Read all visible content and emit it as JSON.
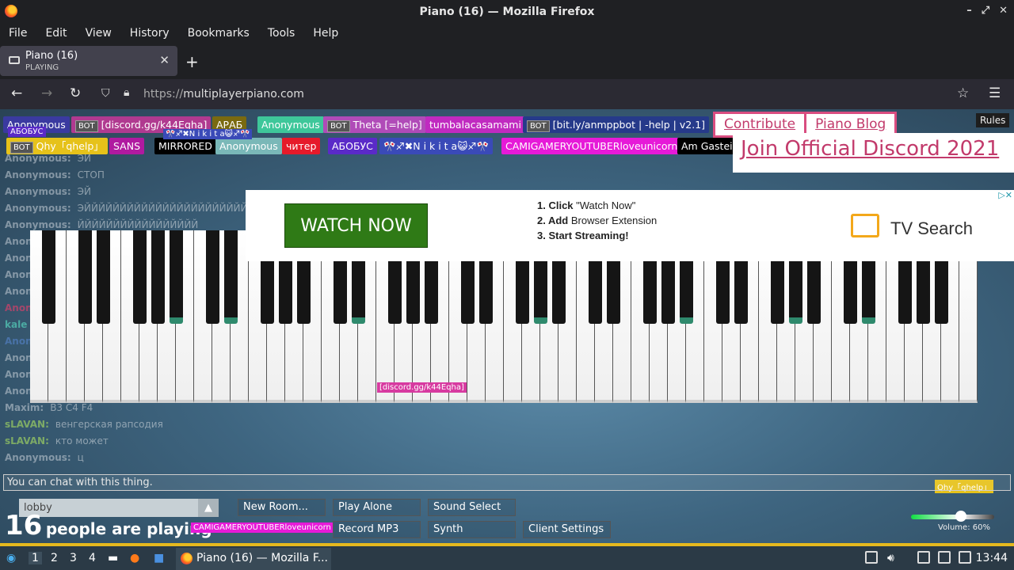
{
  "window": {
    "title": "Piano (16) — Mozilla Firefox"
  },
  "menu": [
    "File",
    "Edit",
    "View",
    "History",
    "Bookmarks",
    "Tools",
    "Help"
  ],
  "tab": {
    "title": "Piano (16)",
    "subtitle": "PLAYING"
  },
  "url": {
    "scheme": "https://",
    "host": "multiplayerpiano.com"
  },
  "chat": [
    {
      "name": "Anonymous:",
      "msg": "ЭЙ",
      "color": "#c8d0d8"
    },
    {
      "name": "Anonymous:",
      "msg": "СТОП",
      "color": "#c8d0d8"
    },
    {
      "name": "Anonymous:",
      "msg": "ЭЙ",
      "color": "#c8d0d8"
    },
    {
      "name": "Anonymous:",
      "msg": "ЭЙЙЙЙЙЙЙЙЙЙЙЙЙЙЙЙЙЙЙЙЙЙЙЙЙЙЙЙЙЙЙЙЙ",
      "color": "#c8d0d8"
    },
    {
      "name": "Anonymous:",
      "msg": "ЙЙЙЙЙЙЙЙЙЙЙЙЙЙЙЙЙ",
      "color": "#c8d0d8"
    },
    {
      "name": "Anon",
      "msg": "",
      "color": "#c8d0d8"
    },
    {
      "name": "Anon",
      "msg": "",
      "color": "#c8d0d8"
    },
    {
      "name": "Anon",
      "msg": "",
      "color": "#c8d0d8"
    },
    {
      "name": "Anon",
      "msg": "",
      "color": "#c8d0d8"
    },
    {
      "name": "Anon",
      "msg": "",
      "color": "#ff3b6a"
    },
    {
      "name": "kale",
      "msg": "",
      "color": "#5ef0d0"
    },
    {
      "name": "Anon",
      "msg": "",
      "color": "#5a8ad8"
    },
    {
      "name": "Anon",
      "msg": "",
      "color": "#c8d0d8"
    },
    {
      "name": "Anon",
      "msg": "",
      "color": "#c8d0d8"
    },
    {
      "name": "Anon",
      "msg": "",
      "color": "#c8d0d8"
    },
    {
      "name": "Maxim:",
      "msg": "B3 C4 F4",
      "color": "#c8d0d8"
    },
    {
      "name": "sLAVAN:",
      "msg": "венгерская рапсодия",
      "color": "#b8f060"
    },
    {
      "name": "sLAVAN:",
      "msg": "кто может",
      "color": "#b8f060"
    },
    {
      "name": "Anonymous:",
      "msg": "ц",
      "color": "#c8d0d8"
    }
  ],
  "users_row1": [
    {
      "label": "Anonymous",
      "bot": false,
      "color": "#3a3aa0"
    },
    {
      "label": "[discord.gg/k44Eqha]",
      "bot": true,
      "color": "#b03a90"
    },
    {
      "label": "АРАБ",
      "bot": false,
      "color": "#7a6a10"
    },
    {
      "label": "Anonymous",
      "bot": false,
      "color": "#3ec79a"
    },
    {
      "label": "Theta [=help]",
      "bot": true,
      "color": "#b04bb8"
    },
    {
      "label": "tumbalacasamami",
      "bot": false,
      "color": "#c02ac0"
    },
    {
      "label": "[bit.ly/anmppbot | -help | v2.1]",
      "bot": true,
      "color": "#263a8a"
    }
  ],
  "users_row2": [
    {
      "label": "Qhy「qhelp」",
      "bot": true,
      "color": "#e6c21a"
    },
    {
      "label": "SANS",
      "bot": false,
      "color": "#b01aa0"
    },
    {
      "label": "MIRRORED",
      "bot": false,
      "color": "#000000"
    },
    {
      "label": "Anonymous",
      "bot": false,
      "color": "#7ab8b8"
    },
    {
      "label": "читер",
      "bot": false,
      "color": "#e61a2a"
    },
    {
      "label": "АБОБУС",
      "bot": false,
      "color": "#5a2ac8"
    },
    {
      "label": "🎌♐✖N i k i t a😺♐🎌",
      "bot": false,
      "color": "#3a4ab8"
    },
    {
      "label": "CAMIGAMERYOUTUBERloveunicorn",
      "bot": false,
      "color": "#e61ad8"
    },
    {
      "label": "Am Gasteig",
      "bot": false,
      "color": "#000000"
    }
  ],
  "links": {
    "contribute": "Contribute",
    "blog": "Piano Blog",
    "discord": "Join Official Discord 2021",
    "rules": "Rules"
  },
  "ad": {
    "button": "WATCH NOW",
    "steps": [
      {
        "bold": "1. Click",
        "text": "\"Watch Now\""
      },
      {
        "bold": "2. Add",
        "text": "Browser Extension"
      },
      {
        "bold": "3. Start Streaming!",
        "text": ""
      }
    ],
    "brand": "TV Search"
  },
  "piano_tags": {
    "discord": "[discord.gg/k44Eqha]",
    "qhy": "Qhy「qhelp」",
    "cami": "CAMIGAMERYOUTUBERloveunicorn",
    "abobus": "АБОБУС",
    "nikita": "🎌♐✖N i k i t a😺♐🎌"
  },
  "chat_input": {
    "placeholder": "You can chat with this thing."
  },
  "room": {
    "value": "lobby"
  },
  "people": {
    "count": "16",
    "label": "people are playing"
  },
  "buttons": {
    "new_room": "New Room...",
    "play_alone": "Play Alone",
    "sound_select": "Sound Select",
    "record_mp3": "Record MP3",
    "synth": "Synth",
    "client_settings": "Client Settings"
  },
  "volume": {
    "label": "Volume: 60%",
    "level": 0.6
  },
  "taskbar": {
    "workspaces": [
      "1",
      "2",
      "3",
      "4"
    ],
    "window": "Piano (16) — Mozilla F...",
    "clock": "13:44"
  }
}
